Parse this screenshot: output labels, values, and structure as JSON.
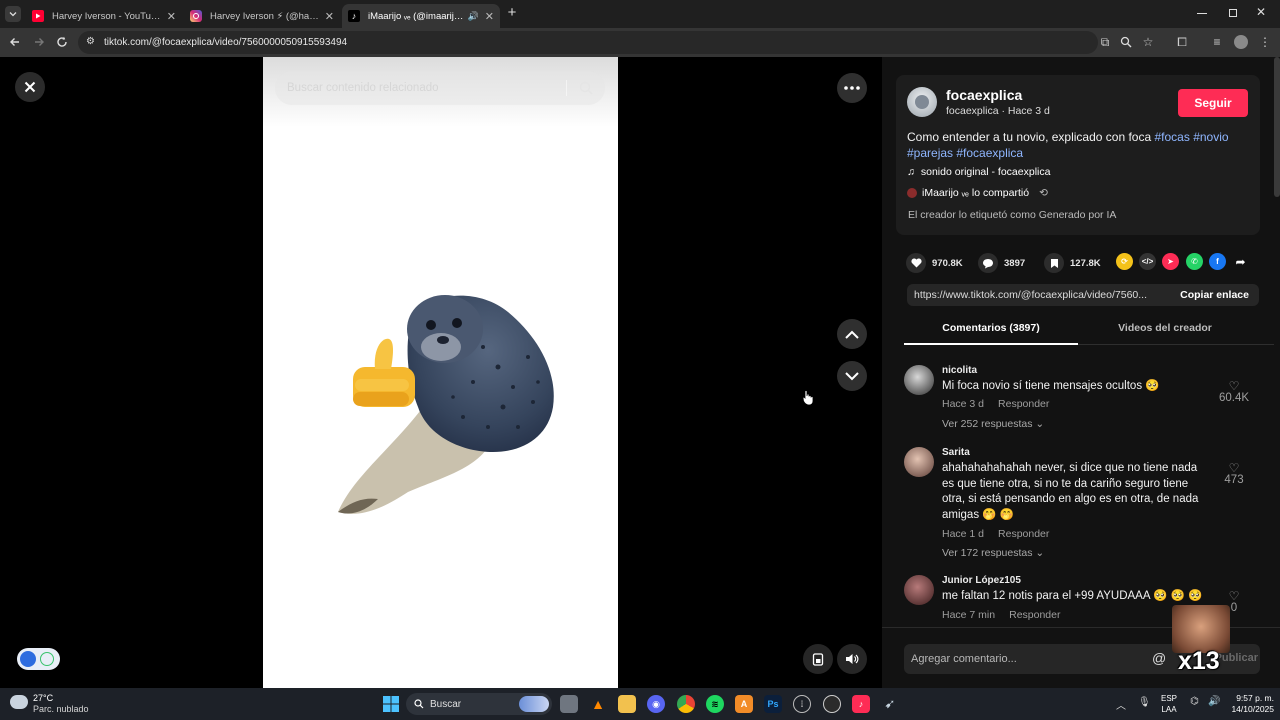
{
  "browser": {
    "tabs": [
      {
        "title": "Harvey Iverson - YouTube",
        "active": false
      },
      {
        "title": "Harvey Iverson ⚡ (@harveyiverson)",
        "active": false
      },
      {
        "title": "iMaarijo ᵥₑ (@imaarijo) | TikTok",
        "active": true
      }
    ],
    "url": "tiktok.com/@focaexplica/video/7560000050915593494"
  },
  "video": {
    "search_placeholder": "Buscar contenido relacionado"
  },
  "post": {
    "username": "focaexplica",
    "subline": "focaexplica · Hace 3 d",
    "follow_label": "Seguir",
    "caption_text": "Como entender a tu novio, explicado con foca ",
    "hashtags_1": "#focas #novio",
    "hashtags_2": "#parejas #focaexplica",
    "sound": "sonido original - focaexplica",
    "shared_by": "iMaarijo ᵥₑ lo compartió",
    "ai_label": "El creador lo etiquetó como Generado por IA",
    "likes": "970.8K",
    "comments": "3897",
    "saves": "127.8K",
    "link": "https://www.tiktok.com/@focaexplica/video/7560...",
    "copy_label": "Copiar enlace"
  },
  "panel_tabs": {
    "comments": "Comentarios (3897)",
    "creator_videos": "Videos del creador"
  },
  "comments": [
    {
      "user": "nicolita",
      "text": "Mi foca novio sí tiene mensajes ocultos 🥺",
      "time": "Hace 3 d",
      "reply": "Responder",
      "likes": "60.4K",
      "replies": "Ver 252 respuestas"
    },
    {
      "user": "Sarita",
      "text": "ahahahahahahah never, si dice que no tiene nada es que tiene otra, si no te da cariño seguro tiene otra, si está pensando en algo es en otra, de nada amigas 🤭 🤭",
      "time": "Hace 1 d",
      "reply": "Responder",
      "likes": "473",
      "replies": "Ver 172 respuestas"
    },
    {
      "user": "Junior López105",
      "text": "me faltan 12 notis para el +99 AYUDAAA 🥺 🥺 🥺",
      "time": "Hace 7 min",
      "reply": "Responder",
      "likes": "0"
    }
  ],
  "comment_input": {
    "placeholder": "Agregar comentario...",
    "publish_label": "Publicar"
  },
  "overlay": {
    "badge": "x13"
  },
  "taskbar": {
    "weather_temp": "27°C",
    "weather_desc": "Parc. nublado",
    "search_label": "Buscar",
    "lang_1": "ESP",
    "lang_2": "LAA",
    "time": "9:57 p. m.",
    "date": "14/10/2025"
  },
  "colors": {
    "accent": "#fe2c55",
    "hashtag": "#8fb6ff",
    "panel": "#121212"
  }
}
